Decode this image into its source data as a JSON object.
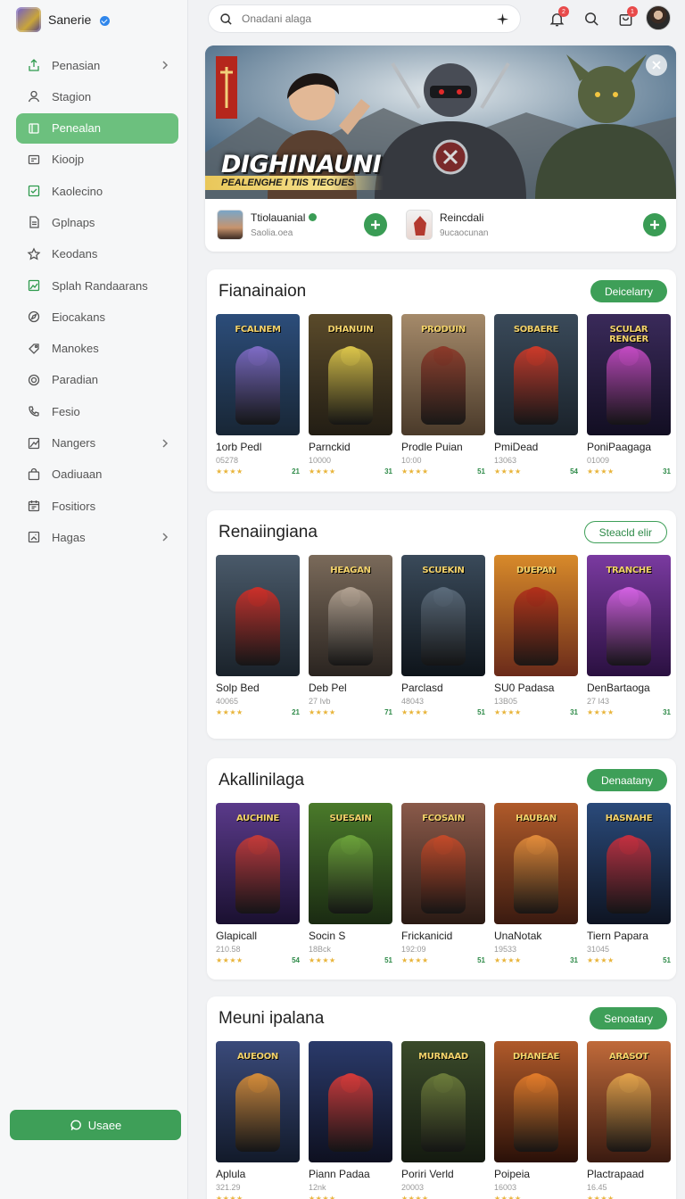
{
  "brand": {
    "name": "Sanerie"
  },
  "sidebar": {
    "items": [
      {
        "label": "Penasian",
        "icon": "share-icon",
        "chevron": true
      },
      {
        "label": "Stagion",
        "icon": "user-icon",
        "chevron": false
      },
      {
        "label": "Penealan",
        "icon": "square-icon",
        "chevron": false,
        "active": true
      },
      {
        "label": "Kioojp",
        "icon": "card-icon",
        "chevron": false
      },
      {
        "label": "Kaolecino",
        "icon": "checkbox-icon",
        "chevron": false
      },
      {
        "label": "Gplnaps",
        "icon": "document-icon",
        "chevron": false
      },
      {
        "label": "Keodans",
        "icon": "star-icon",
        "chevron": false
      },
      {
        "label": "Splah Randaarans",
        "icon": "image-icon",
        "chevron": false
      },
      {
        "label": "Eiocakans",
        "icon": "compass-icon",
        "chevron": false
      },
      {
        "label": "Manokes",
        "icon": "tag-icon",
        "chevron": false
      },
      {
        "label": "Paradian",
        "icon": "target-icon",
        "chevron": false
      },
      {
        "label": "Fesio",
        "icon": "phone-icon",
        "chevron": false
      },
      {
        "label": "Nangers",
        "icon": "chart-icon",
        "chevron": true
      },
      {
        "label": "Oadiuaan",
        "icon": "bag-icon",
        "chevron": false
      },
      {
        "label": "Fositiors",
        "icon": "calendar-icon",
        "chevron": false
      },
      {
        "label": "Hagas",
        "icon": "photo-icon",
        "chevron": true
      }
    ],
    "cta_label": "Usaee"
  },
  "search": {
    "placeholder": "Onadani alaga"
  },
  "topbar": {
    "notifications_badge": "2",
    "cart_badge": "1"
  },
  "hero": {
    "title": "DIGHINAUNI",
    "subtitle": "PEALENGHE I TIIS TIEGUES",
    "featured": [
      {
        "title": "Ttiolauanial",
        "subtitle": "Saolia.oea",
        "verified": true
      },
      {
        "title": "Reincdali",
        "subtitle": "9ucaocunan",
        "verified": false
      }
    ]
  },
  "sections": [
    {
      "title": "Fianainaion",
      "button": "Deicelarry",
      "button_style": "filled",
      "cards": [
        {
          "poster_title": "FCALNEM",
          "title": "1orb Pedl",
          "count": "05278",
          "score": "21",
          "colors": [
            "#2c4d7a",
            "#182635",
            "#7c6ac2"
          ]
        },
        {
          "poster_title": "DHANUIN",
          "title": "Parnckid",
          "count": "10000",
          "score": "31",
          "colors": [
            "#5a4a2a",
            "#221d14",
            "#d8c24a"
          ]
        },
        {
          "poster_title": "PRODUIN",
          "title": "Prodle Puian",
          "count": "10:00",
          "score": "51",
          "colors": [
            "#a58a6a",
            "#4a3a2a",
            "#8a3a2a"
          ]
        },
        {
          "poster_title": "SOBAERE",
          "title": "PmiDead",
          "count": "13063",
          "score": "54",
          "colors": [
            "#3a4a5a",
            "#1a222a",
            "#c83a2a"
          ]
        },
        {
          "poster_title": "SCULAR RENGER",
          "title": "PoniPaagaga",
          "count": "01009",
          "score": "31",
          "colors": [
            "#3a2a5a",
            "#120e22",
            "#c04ac0"
          ]
        }
      ]
    },
    {
      "title": "Renaiingiana",
      "button": "Steacld elir",
      "button_style": "outline",
      "cards": [
        {
          "poster_title": "",
          "title": "Solp Bed",
          "count": "40065",
          "score": "21",
          "colors": [
            "#4a5a6a",
            "#1a222a",
            "#c8302a"
          ]
        },
        {
          "poster_title": "HEAGAN",
          "title": "Deb Pel",
          "count": "27 Ivb",
          "score": "71",
          "colors": [
            "#7a6a5a",
            "#2a2420",
            "#b0a090"
          ]
        },
        {
          "poster_title": "SCUEKIN",
          "title": "Parclasd",
          "count": "48043",
          "score": "51",
          "colors": [
            "#3a4a5a",
            "#0e141a",
            "#5a6a7a"
          ]
        },
        {
          "poster_title": "DUEPAN",
          "title": "SU0 Padasa",
          "count": "13B05",
          "score": "31",
          "colors": [
            "#d88a2a",
            "#6a2a1a",
            "#b0301a"
          ]
        },
        {
          "poster_title": "TRANCHE",
          "title": "DenBartaoga",
          "count": "27 I43",
          "score": "31",
          "colors": [
            "#7a3aa0",
            "#2a1040",
            "#d060e0"
          ]
        }
      ]
    },
    {
      "title": "Akallinilaga",
      "button": "Denaatany",
      "button_style": "filled",
      "cards": [
        {
          "poster_title": "AUCHINE",
          "title": "Glapicall",
          "count": "210.58",
          "score": "54",
          "colors": [
            "#5a3a8a",
            "#1a1030",
            "#c03a3a"
          ]
        },
        {
          "poster_title": "SUESAIN",
          "title": "Socin S",
          "count": "18Bck",
          "score": "51",
          "colors": [
            "#4a7a2a",
            "#1a2a12",
            "#6aa03a"
          ]
        },
        {
          "poster_title": "FCOSAIN",
          "title": "Frickanicid",
          "count": "192:09",
          "score": "51",
          "colors": [
            "#8a5a4a",
            "#2a1a14",
            "#c04a2a"
          ]
        },
        {
          "poster_title": "HAUBAN",
          "title": "UnaNotak",
          "count": "19533",
          "score": "31",
          "colors": [
            "#b05a2a",
            "#3a1a10",
            "#e08a3a"
          ]
        },
        {
          "poster_title": "HASNAHE",
          "title": "Tiern Papara",
          "count": "31045",
          "score": "51",
          "colors": [
            "#2a4a7a",
            "#0e1422",
            "#c03040"
          ]
        }
      ]
    },
    {
      "title": "Meuni ipalana",
      "button": "Senoatary",
      "button_style": "filled",
      "cards": [
        {
          "poster_title": "AUEOON",
          "title": "Aplula",
          "count": "321.29",
          "score": "",
          "colors": [
            "#3a4a7a",
            "#121a2a",
            "#d08a3a"
          ]
        },
        {
          "poster_title": "",
          "title": "Piann Padaa",
          "count": "12nk",
          "score": "",
          "colors": [
            "#2a3a6a",
            "#0e1020",
            "#d03a3a"
          ]
        },
        {
          "poster_title": "MURNAAD",
          "title": "Poriri Verld",
          "count": "20003",
          "score": "",
          "colors": [
            "#3a4a2a",
            "#141a10",
            "#6a7a3a"
          ]
        },
        {
          "poster_title": "DHANEAE",
          "title": "Poipeia",
          "count": "16003",
          "score": "",
          "colors": [
            "#b05a2a",
            "#2a1008",
            "#e07a2a"
          ]
        },
        {
          "poster_title": "ARASOT",
          "title": "Plactrapaad",
          "count": "16.45",
          "score": "",
          "colors": [
            "#c06a3a",
            "#3a1a10",
            "#e0a04a"
          ]
        }
      ]
    }
  ]
}
